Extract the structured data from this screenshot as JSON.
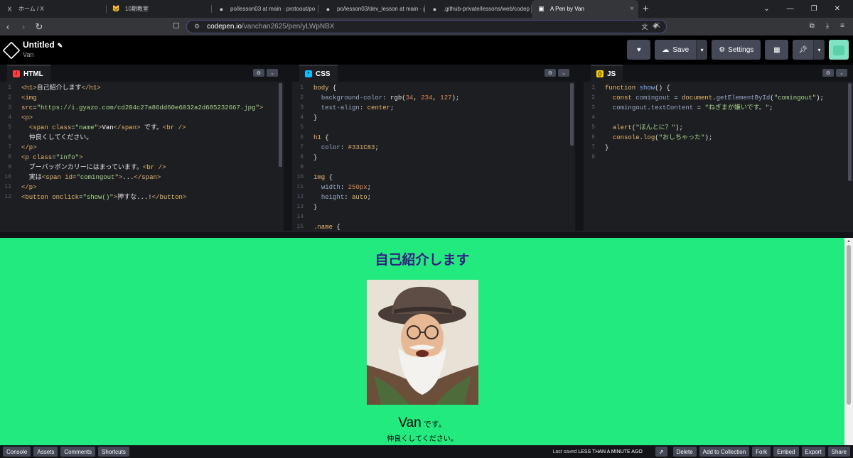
{
  "browser": {
    "tabs": [
      {
        "icon": "X",
        "label": "ホーム / X",
        "icon_name": "x-logo-icon"
      },
      {
        "icon": "🐱",
        "label": "10期教室",
        "icon_name": "cat-icon"
      },
      {
        "icon": "●",
        "label": "po/lesson03 at main · protoout/po",
        "icon_name": "github-icon"
      },
      {
        "icon": "●",
        "label": "po/lesson03/dev_lesson at main · pr",
        "icon_name": "github-icon"
      },
      {
        "icon": "●",
        "label": ".github-private/lessons/web/codep",
        "icon_name": "github-icon"
      },
      {
        "icon": "▣",
        "label": "A Pen by Van",
        "icon_name": "codepen-icon",
        "active": true
      }
    ],
    "url_host": "codepen.io",
    "url_path": "/vanchan2625/pen/yLWpNBX"
  },
  "header": {
    "title": "Untitled",
    "author": "Van",
    "save_label": "Save",
    "settings_label": "Settings"
  },
  "panes": {
    "html": {
      "label": "HTML",
      "icon_color": "#ff3c41"
    },
    "css": {
      "label": "CSS",
      "icon_color": "#0ebeff"
    },
    "js": {
      "label": "JS",
      "icon_color": "#fcd000"
    }
  },
  "html_code": [
    [
      [
        "#e8b86d",
        "<h1>"
      ],
      [
        "#e6e6e6",
        "自己紹介します"
      ],
      [
        "#e8b86d",
        "</h1>"
      ]
    ],
    [
      [
        "#e8b86d",
        "<img"
      ]
    ],
    [
      [
        "#e8b86d",
        "src"
      ],
      [
        "#e6e6e6",
        "="
      ],
      [
        "#a8d38a",
        "\"https://i.gyazo.com/cd204c27a86dd60e6032a2d685232667.jpg\""
      ],
      [
        "#e8b86d",
        ">"
      ]
    ],
    [
      [
        "#e8b86d",
        "<p>"
      ]
    ],
    [
      [
        "#e6e6e6",
        "  "
      ],
      [
        "#e8b86d",
        "<span "
      ],
      [
        "#e8b86d",
        "class"
      ],
      [
        "#e6e6e6",
        "="
      ],
      [
        "#a8d38a",
        "\"name\""
      ],
      [
        "#e8b86d",
        ">"
      ],
      [
        "#ffffff",
        "Van"
      ],
      [
        "#e8b86d",
        "</span>"
      ],
      [
        "#e6e6e6",
        " です。"
      ],
      [
        "#e8b86d",
        "<br />"
      ]
    ],
    [
      [
        "#e6e6e6",
        "  仲良くしてください。"
      ]
    ],
    [
      [
        "#e8b86d",
        "</p>"
      ]
    ],
    [
      [
        "#e8b86d",
        "<p "
      ],
      [
        "#e8b86d",
        "class"
      ],
      [
        "#e6e6e6",
        "="
      ],
      [
        "#a8d38a",
        "\"info\""
      ],
      [
        "#e8b86d",
        ">"
      ]
    ],
    [
      [
        "#e6e6e6",
        "  ブーバッボンカリーにはまっています。"
      ],
      [
        "#e8b86d",
        "<br />"
      ]
    ],
    [
      [
        "#e6e6e6",
        "  実は"
      ],
      [
        "#e8b86d",
        "<span "
      ],
      [
        "#e8b86d",
        "id"
      ],
      [
        "#e6e6e6",
        "="
      ],
      [
        "#a8d38a",
        "\"comingout\""
      ],
      [
        "#e8b86d",
        ">"
      ],
      [
        "#e6e6e6",
        "..."
      ],
      [
        "#e8b86d",
        "</span>"
      ]
    ],
    [
      [
        "#e8b86d",
        "</p>"
      ]
    ],
    [
      [
        "#e8b86d",
        "<button "
      ],
      [
        "#e8b86d",
        "onclick"
      ],
      [
        "#e6e6e6",
        "="
      ],
      [
        "#a8d38a",
        "\"show()\""
      ],
      [
        "#e8b86d",
        ">"
      ],
      [
        "#e6e6e6",
        "押すな...!"
      ],
      [
        "#e8b86d",
        "</button>"
      ]
    ]
  ],
  "css_code": [
    [
      [
        "#e8b86d",
        "body"
      ],
      [
        "#e6e6e6",
        " {"
      ]
    ],
    [
      [
        "#e6e6e6",
        "  "
      ],
      [
        "#9aa7c7",
        "background-color"
      ],
      [
        "#e6e6e6",
        ": "
      ],
      [
        "#e6e6e6",
        "rgb("
      ],
      [
        "#e08850",
        "34"
      ],
      [
        "#e6e6e6",
        ", "
      ],
      [
        "#e08850",
        "234"
      ],
      [
        "#e6e6e6",
        ", "
      ],
      [
        "#e08850",
        "127"
      ],
      [
        "#e6e6e6",
        ");"
      ]
    ],
    [
      [
        "#e6e6e6",
        "  "
      ],
      [
        "#9aa7c7",
        "text-align"
      ],
      [
        "#e6e6e6",
        ": "
      ],
      [
        "#e8b86d",
        "center"
      ],
      [
        "#e6e6e6",
        ";"
      ]
    ],
    [
      [
        "#e6e6e6",
        "}"
      ]
    ],
    [],
    [
      [
        "#e8b86d",
        "h1"
      ],
      [
        "#e6e6e6",
        " {"
      ]
    ],
    [
      [
        "#e6e6e6",
        "  "
      ],
      [
        "#9aa7c7",
        "color"
      ],
      [
        "#e6e6e6",
        ": "
      ],
      [
        "#e8b86d",
        "#331C83"
      ],
      [
        "#e6e6e6",
        ";"
      ]
    ],
    [
      [
        "#e6e6e6",
        "}"
      ]
    ],
    [],
    [
      [
        "#e8b86d",
        "img"
      ],
      [
        "#e6e6e6",
        " {"
      ]
    ],
    [
      [
        "#e6e6e6",
        "  "
      ],
      [
        "#9aa7c7",
        "width"
      ],
      [
        "#e6e6e6",
        ": "
      ],
      [
        "#e08850",
        "250px"
      ],
      [
        "#e6e6e6",
        ";"
      ]
    ],
    [
      [
        "#e6e6e6",
        "  "
      ],
      [
        "#9aa7c7",
        "height"
      ],
      [
        "#e6e6e6",
        ": "
      ],
      [
        "#e8b86d",
        "auto"
      ],
      [
        "#e6e6e6",
        ";"
      ]
    ],
    [
      [
        "#e6e6e6",
        "}"
      ]
    ],
    [],
    [
      [
        "#e8b86d",
        ".name"
      ],
      [
        "#e6e6e6",
        " {"
      ]
    ]
  ],
  "js_code": [
    [
      [
        "#e8b86d",
        "function "
      ],
      [
        "#80b3ff",
        "show"
      ],
      [
        "#e6e6e6",
        "() {"
      ]
    ],
    [
      [
        "#e6e6e6",
        "  "
      ],
      [
        "#e8b86d",
        "const "
      ],
      [
        "#9aa7c7",
        "comingout"
      ],
      [
        "#e6e6e6",
        " = "
      ],
      [
        "#e8b86d",
        "document"
      ],
      [
        "#e6e6e6",
        "."
      ],
      [
        "#9aa7c7",
        "getElementById"
      ],
      [
        "#e6e6e6",
        "("
      ],
      [
        "#a8d38a",
        "\"comingout\""
      ],
      [
        "#e6e6e6",
        ");"
      ]
    ],
    [
      [
        "#e6e6e6",
        "  "
      ],
      [
        "#9aa7c7",
        "comingout"
      ],
      [
        "#e6e6e6",
        "."
      ],
      [
        "#9aa7c7",
        "textContent"
      ],
      [
        "#e6e6e6",
        " = "
      ],
      [
        "#a8d38a",
        "\"ねぎまが嫌いです。\""
      ],
      [
        "#e6e6e6",
        ";"
      ]
    ],
    [],
    [
      [
        "#e6e6e6",
        "  "
      ],
      [
        "#e8b86d",
        "alert"
      ],
      [
        "#e6e6e6",
        "("
      ],
      [
        "#a8d38a",
        "\"ほんとに？\""
      ],
      [
        "#e6e6e6",
        ");"
      ]
    ],
    [
      [
        "#e6e6e6",
        "  "
      ],
      [
        "#e8b86d",
        "console"
      ],
      [
        "#e6e6e6",
        "."
      ],
      [
        "#e8b86d",
        "log"
      ],
      [
        "#e6e6e6",
        "("
      ],
      [
        "#a8d38a",
        "\"おしちゃった\""
      ],
      [
        "#e6e6e6",
        ");"
      ]
    ],
    [
      [
        "#e6e6e6",
        "}"
      ]
    ],
    []
  ],
  "preview": {
    "heading": "自己紹介します",
    "name": "Van",
    "desu": "です。",
    "friendly": "仲良くしてください。"
  },
  "footer": {
    "left_buttons": [
      "Console",
      "Assets",
      "Comments",
      "Shortcuts"
    ],
    "last_saved_prefix": "Last saved",
    "last_saved_time": "LESS THAN A MINUTE AGO",
    "right_buttons": [
      "Delete",
      "Add to Collection",
      "Fork",
      "Embed",
      "Export",
      "Share"
    ]
  }
}
